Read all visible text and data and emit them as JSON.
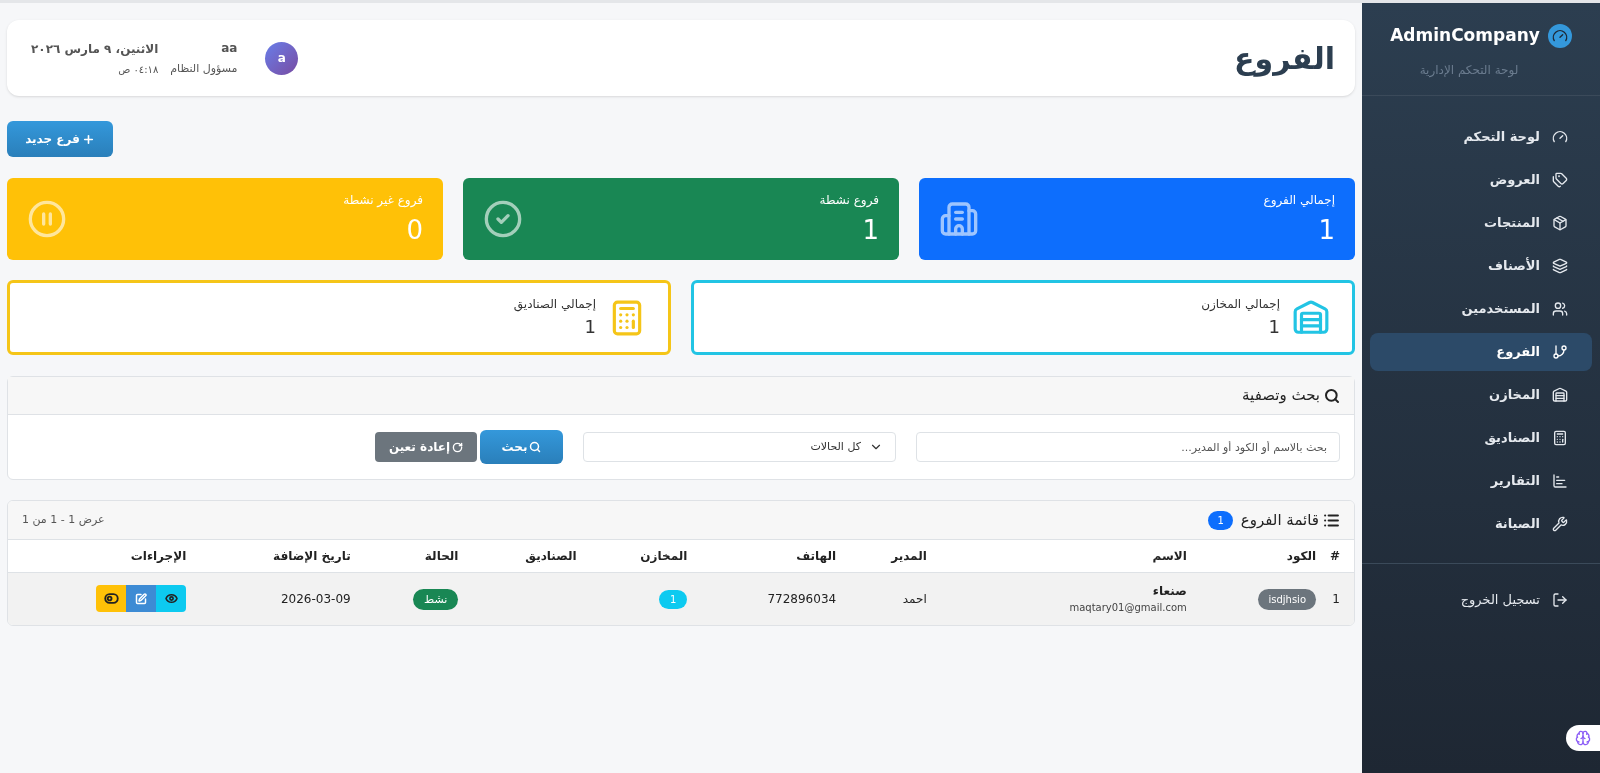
{
  "sidebar": {
    "brand": "AdminCompany",
    "subtitle": "لوحة التحكم الإدارية",
    "items": [
      {
        "label": "لوحة التحكم",
        "selected": false
      },
      {
        "label": "العروض",
        "selected": false
      },
      {
        "label": "المنتجات",
        "selected": false
      },
      {
        "label": "الأصناف",
        "selected": false
      },
      {
        "label": "المستخدمين",
        "selected": false
      },
      {
        "label": "الفروع",
        "selected": true
      },
      {
        "label": "المخازن",
        "selected": false
      },
      {
        "label": "الصناديق",
        "selected": false
      },
      {
        "label": "التقارير",
        "selected": false
      },
      {
        "label": "الصيانة",
        "selected": false
      }
    ],
    "logout": "تسجيل الخروج"
  },
  "header": {
    "title": "الفروع",
    "user_initial": "a",
    "user_name": "aa",
    "user_role": "مسؤول النظام",
    "date": "الاثنين، ٩ مارس ٢٠٢٦",
    "time": "٠٤:١٨ ص"
  },
  "new_button": "فرع جديد",
  "stats": [
    {
      "title": "إجمالي الفروع",
      "value": "1",
      "color": "#0d6efd"
    },
    {
      "title": "فروع نشطة",
      "value": "1",
      "color": "#198754"
    },
    {
      "title": "فروع غير نشطة",
      "value": "0",
      "color": "#ffc107"
    }
  ],
  "summary": [
    {
      "title": "إجمالي المخازن",
      "value": "1",
      "color": "#22c4e4"
    },
    {
      "title": "إجمالي الصناديق",
      "value": "1",
      "color": "#f5c518"
    }
  ],
  "filter": {
    "title": "بحث وتصفية",
    "search_placeholder": "بحث بالاسم أو الكود أو المدير...",
    "status_value": "كل الحالات",
    "search_button": "بحث",
    "reset_button": "إعادة تعين"
  },
  "table": {
    "title": "قائمة الفروع",
    "count": "1",
    "showing": "عرض 1 - 1 من 1",
    "columns": [
      "#",
      "الكود",
      "الاسم",
      "المدير",
      "الهاتف",
      "المخازن",
      "الصناديق",
      "الحالة",
      "تاريخ الإضافة",
      "الإجراءات"
    ],
    "rows": [
      {
        "index": "1",
        "code": "isdjhsio",
        "name": "صنعاء",
        "email": "maqtary01@gmail.com",
        "manager": "احمد",
        "phone": "772896034",
        "warehouses": "1",
        "status": "نشط",
        "date": "2026-03-09"
      }
    ]
  }
}
